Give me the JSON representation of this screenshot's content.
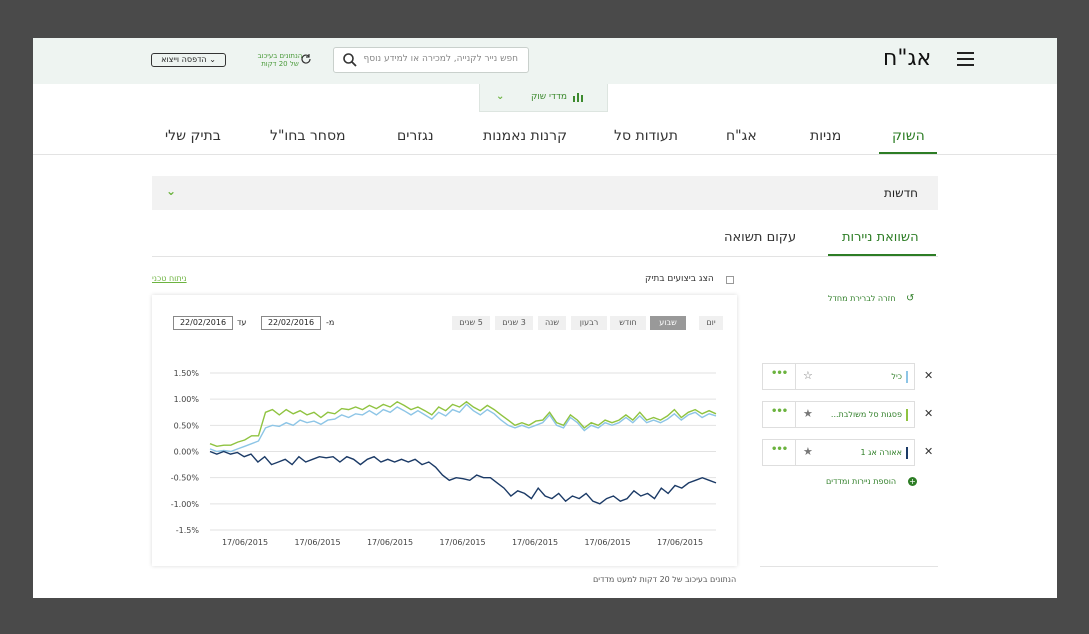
{
  "header": {
    "logo": "אג\"ח",
    "search_placeholder": "חפש נייר לקנייה, למכירה או למידע נוסף",
    "delay_notice_line1": "הנתונים בעיכוב",
    "delay_notice_line2": "של 20 דקות",
    "print_label": "הדפסה וייצוא"
  },
  "market_tab": {
    "label": "מדדי שוק"
  },
  "nav": {
    "items": [
      "השוק",
      "מניות",
      "אג\"ח",
      "תעודות סל",
      "קרנות נאמנות",
      "נגזרים",
      "מסחר בחו\"ל",
      "בתיק שלי"
    ],
    "active": "השוק"
  },
  "news": {
    "label": "חדשות"
  },
  "subtabs": {
    "compare": "השוואת ניירות",
    "curve": "עקום תשואה"
  },
  "options": {
    "tech_link": "ניתוח טכני",
    "show_perf": "הצג ביצועים בתיק"
  },
  "ranges": [
    "יום",
    "שבוע",
    "חודש",
    "רבעון",
    "שנה",
    "3 שנים",
    "5 שנים"
  ],
  "active_range": "שבוע",
  "date_from_label": "מ-",
  "date_from": "22/02/2016",
  "date_to_label": "עד",
  "date_to": "22/02/2016",
  "footnote": "הנתונים בעיכוב של 20 דקות למעט מדדים",
  "side": {
    "back_link": "חזרה לברירת מחדל",
    "add_link": "הוספת ניירות ומדדים",
    "securities": [
      {
        "name": "כיל",
        "color": "#8dc5e6",
        "starred": false
      },
      {
        "name": "פסגות סל משולבת...",
        "color": "#8fc340",
        "starred": true
      },
      {
        "name": "אאורה אג 1",
        "color": "#1b3a66",
        "starred": true
      }
    ]
  },
  "chart_data": {
    "type": "line",
    "x_ticks": [
      "17/06/2015",
      "17/06/2015",
      "17/06/2015",
      "17/06/2015",
      "17/06/2015",
      "17/06/2015",
      "17/06/2015"
    ],
    "y_ticks": [
      "1.50%",
      "1.00%",
      "0.50%",
      "0.00%",
      "-0.50%",
      "-1.00%",
      "-1.5%"
    ],
    "ylim": [
      -1.5,
      1.5
    ],
    "grid": true,
    "series": [
      {
        "name": "פסגות סל משולבת...",
        "color": "#8fc340",
        "values": [
          0.15,
          0.1,
          0.12,
          0.12,
          0.18,
          0.22,
          0.3,
          0.3,
          0.75,
          0.8,
          0.7,
          0.8,
          0.72,
          0.78,
          0.7,
          0.75,
          0.65,
          0.75,
          0.72,
          0.82,
          0.8,
          0.85,
          0.8,
          0.88,
          0.82,
          0.9,
          0.85,
          0.95,
          0.88,
          0.8,
          0.85,
          0.78,
          0.7,
          0.85,
          0.78,
          0.9,
          0.85,
          0.95,
          0.85,
          0.78,
          0.88,
          0.8,
          0.7,
          0.6,
          0.5,
          0.55,
          0.5,
          0.58,
          0.6,
          0.75,
          0.55,
          0.5,
          0.7,
          0.6,
          0.45,
          0.55,
          0.5,
          0.6,
          0.55,
          0.6,
          0.7,
          0.6,
          0.75,
          0.6,
          0.65,
          0.6,
          0.68,
          0.8,
          0.65,
          0.75,
          0.8,
          0.72,
          0.78,
          0.72
        ]
      },
      {
        "name": "כיל",
        "color": "#8dc5e6",
        "values": [
          0.05,
          0.0,
          0.02,
          0.0,
          0.05,
          0.1,
          0.15,
          0.2,
          0.45,
          0.5,
          0.48,
          0.55,
          0.5,
          0.6,
          0.55,
          0.58,
          0.52,
          0.6,
          0.62,
          0.7,
          0.65,
          0.72,
          0.7,
          0.78,
          0.7,
          0.8,
          0.75,
          0.85,
          0.78,
          0.7,
          0.78,
          0.7,
          0.62,
          0.75,
          0.68,
          0.8,
          0.75,
          0.9,
          0.78,
          0.7,
          0.8,
          0.72,
          0.6,
          0.5,
          0.45,
          0.5,
          0.45,
          0.5,
          0.55,
          0.7,
          0.5,
          0.45,
          0.65,
          0.55,
          0.4,
          0.5,
          0.45,
          0.55,
          0.5,
          0.55,
          0.65,
          0.55,
          0.68,
          0.55,
          0.6,
          0.55,
          0.62,
          0.72,
          0.6,
          0.7,
          0.75,
          0.65,
          0.72,
          0.68
        ]
      },
      {
        "name": "אאורה אג 1",
        "color": "#1b3a66",
        "values": [
          0.0,
          -0.05,
          0.0,
          -0.05,
          -0.02,
          -0.1,
          -0.05,
          -0.2,
          -0.1,
          -0.25,
          -0.2,
          -0.15,
          -0.25,
          -0.1,
          -0.2,
          -0.15,
          -0.1,
          -0.12,
          -0.1,
          -0.2,
          -0.1,
          -0.15,
          -0.25,
          -0.15,
          -0.1,
          -0.2,
          -0.15,
          -0.2,
          -0.15,
          -0.2,
          -0.15,
          -0.25,
          -0.2,
          -0.3,
          -0.45,
          -0.55,
          -0.5,
          -0.52,
          -0.55,
          -0.45,
          -0.5,
          -0.5,
          -0.6,
          -0.7,
          -0.85,
          -0.75,
          -0.8,
          -0.9,
          -0.7,
          -0.85,
          -0.9,
          -0.8,
          -0.95,
          -0.85,
          -0.9,
          -0.8,
          -0.95,
          -1.0,
          -0.9,
          -0.85,
          -0.95,
          -0.9,
          -0.75,
          -0.85,
          -0.8,
          -0.9,
          -0.7,
          -0.8,
          -0.65,
          -0.7,
          -0.6,
          -0.55,
          -0.5,
          -0.55,
          -0.6
        ]
      }
    ]
  }
}
